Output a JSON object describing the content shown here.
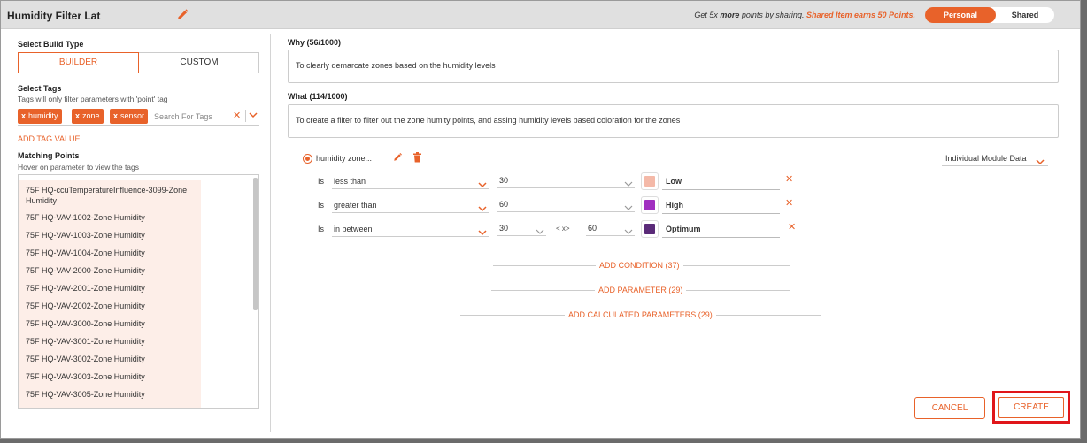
{
  "header": {
    "title": "Humidity Filter Lat",
    "share_prefix": "Get 5x ",
    "share_more": "more",
    "share_mid": " points by sharing. ",
    "share_accent": "Shared Item earns 50 Points.",
    "toggle_personal": "Personal",
    "toggle_shared": "Shared"
  },
  "left": {
    "build_type_label": "Select Build Type",
    "builder": "BUILDER",
    "custom": "CUSTOM",
    "tags_label": "Select Tags",
    "tags_hint": "Tags will only filter parameters with 'point' tag",
    "tags": [
      "humidity",
      "zone",
      "sensor"
    ],
    "tag_search_placeholder": "Search For Tags",
    "add_tag_value": "ADD TAG VALUE",
    "matching_label": "Matching Points",
    "matching_hint": "Hover on parameter to view the tags",
    "points": [
      "75F HQ-ccuTemperatureInfluence-3099-Zone Humidity",
      "75F HQ-VAV-1002-Zone Humidity",
      "75F HQ-VAV-1003-Zone Humidity",
      "75F HQ-VAV-1004-Zone Humidity",
      "75F HQ-VAV-2000-Zone Humidity",
      "75F HQ-VAV-2001-Zone Humidity",
      "75F HQ-VAV-2002-Zone Humidity",
      "75F HQ-VAV-3000-Zone Humidity",
      "75F HQ-VAV-3001-Zone Humidity",
      "75F HQ-VAV-3002-Zone Humidity",
      "75F HQ-VAV-3003-Zone Humidity",
      "75F HQ-VAV-3005-Zone Humidity"
    ]
  },
  "right": {
    "why_label": "Why (56/1000)",
    "why_text": "To  clearly demarcate zones based on the humidity levels",
    "what_label": "What (114/1000)",
    "what_text": "To create a filter to filter out the zone humity points, and assing humidity levels based coloration for the zones",
    "filter_name": "humidity zone...",
    "module_select": "Individual Module Data",
    "conditions": [
      {
        "is": "Is",
        "operator": "less than",
        "value": "30",
        "color": "#f4b9a8",
        "label": "Low"
      },
      {
        "is": "Is",
        "operator": "greater than",
        "value": "60",
        "color": "#a12fc0",
        "label": "High"
      },
      {
        "is": "Is",
        "operator": "in between",
        "value": "30",
        "between": "< x>",
        "value2": "60",
        "color": "#5a2a78",
        "label": "Optimum"
      }
    ],
    "add_condition": "ADD CONDITION (37)",
    "add_parameter": "ADD PARAMETER (29)",
    "add_calculated": "ADD CALCULATED PARAMETERS (29)",
    "cancel": "CANCEL",
    "create": "CREATE"
  },
  "colors": {
    "accent": "#e8622a",
    "highlight": "#e0161a"
  }
}
